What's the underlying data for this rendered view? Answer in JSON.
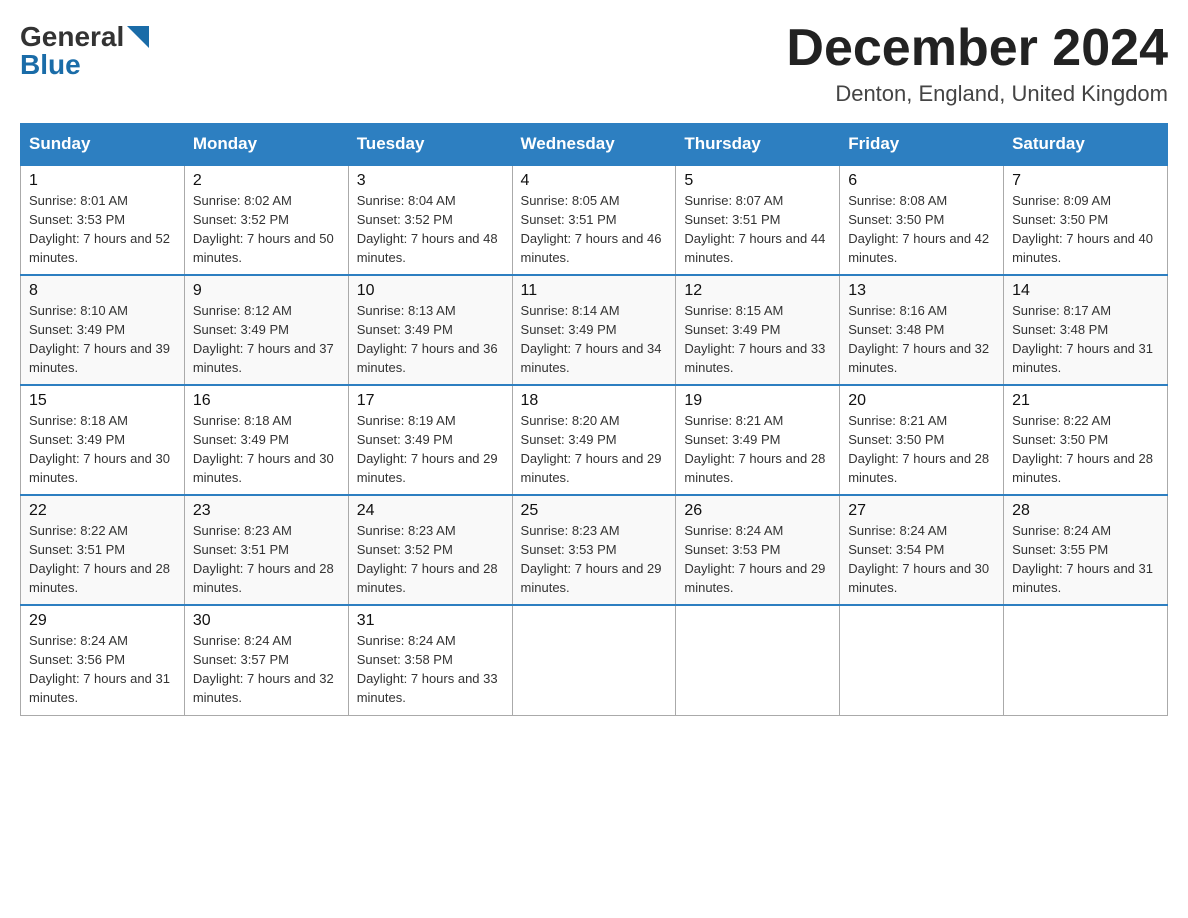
{
  "header": {
    "logo_general": "General",
    "logo_blue": "Blue",
    "month_title": "December 2024",
    "location": "Denton, England, United Kingdom"
  },
  "days_of_week": [
    "Sunday",
    "Monday",
    "Tuesday",
    "Wednesday",
    "Thursday",
    "Friday",
    "Saturday"
  ],
  "weeks": [
    [
      {
        "day": "1",
        "sunrise": "8:01 AM",
        "sunset": "3:53 PM",
        "daylight": "7 hours and 52 minutes."
      },
      {
        "day": "2",
        "sunrise": "8:02 AM",
        "sunset": "3:52 PM",
        "daylight": "7 hours and 50 minutes."
      },
      {
        "day": "3",
        "sunrise": "8:04 AM",
        "sunset": "3:52 PM",
        "daylight": "7 hours and 48 minutes."
      },
      {
        "day": "4",
        "sunrise": "8:05 AM",
        "sunset": "3:51 PM",
        "daylight": "7 hours and 46 minutes."
      },
      {
        "day": "5",
        "sunrise": "8:07 AM",
        "sunset": "3:51 PM",
        "daylight": "7 hours and 44 minutes."
      },
      {
        "day": "6",
        "sunrise": "8:08 AM",
        "sunset": "3:50 PM",
        "daylight": "7 hours and 42 minutes."
      },
      {
        "day": "7",
        "sunrise": "8:09 AM",
        "sunset": "3:50 PM",
        "daylight": "7 hours and 40 minutes."
      }
    ],
    [
      {
        "day": "8",
        "sunrise": "8:10 AM",
        "sunset": "3:49 PM",
        "daylight": "7 hours and 39 minutes."
      },
      {
        "day": "9",
        "sunrise": "8:12 AM",
        "sunset": "3:49 PM",
        "daylight": "7 hours and 37 minutes."
      },
      {
        "day": "10",
        "sunrise": "8:13 AM",
        "sunset": "3:49 PM",
        "daylight": "7 hours and 36 minutes."
      },
      {
        "day": "11",
        "sunrise": "8:14 AM",
        "sunset": "3:49 PM",
        "daylight": "7 hours and 34 minutes."
      },
      {
        "day": "12",
        "sunrise": "8:15 AM",
        "sunset": "3:49 PM",
        "daylight": "7 hours and 33 minutes."
      },
      {
        "day": "13",
        "sunrise": "8:16 AM",
        "sunset": "3:48 PM",
        "daylight": "7 hours and 32 minutes."
      },
      {
        "day": "14",
        "sunrise": "8:17 AM",
        "sunset": "3:48 PM",
        "daylight": "7 hours and 31 minutes."
      }
    ],
    [
      {
        "day": "15",
        "sunrise": "8:18 AM",
        "sunset": "3:49 PM",
        "daylight": "7 hours and 30 minutes."
      },
      {
        "day": "16",
        "sunrise": "8:18 AM",
        "sunset": "3:49 PM",
        "daylight": "7 hours and 30 minutes."
      },
      {
        "day": "17",
        "sunrise": "8:19 AM",
        "sunset": "3:49 PM",
        "daylight": "7 hours and 29 minutes."
      },
      {
        "day": "18",
        "sunrise": "8:20 AM",
        "sunset": "3:49 PM",
        "daylight": "7 hours and 29 minutes."
      },
      {
        "day": "19",
        "sunrise": "8:21 AM",
        "sunset": "3:49 PM",
        "daylight": "7 hours and 28 minutes."
      },
      {
        "day": "20",
        "sunrise": "8:21 AM",
        "sunset": "3:50 PM",
        "daylight": "7 hours and 28 minutes."
      },
      {
        "day": "21",
        "sunrise": "8:22 AM",
        "sunset": "3:50 PM",
        "daylight": "7 hours and 28 minutes."
      }
    ],
    [
      {
        "day": "22",
        "sunrise": "8:22 AM",
        "sunset": "3:51 PM",
        "daylight": "7 hours and 28 minutes."
      },
      {
        "day": "23",
        "sunrise": "8:23 AM",
        "sunset": "3:51 PM",
        "daylight": "7 hours and 28 minutes."
      },
      {
        "day": "24",
        "sunrise": "8:23 AM",
        "sunset": "3:52 PM",
        "daylight": "7 hours and 28 minutes."
      },
      {
        "day": "25",
        "sunrise": "8:23 AM",
        "sunset": "3:53 PM",
        "daylight": "7 hours and 29 minutes."
      },
      {
        "day": "26",
        "sunrise": "8:24 AM",
        "sunset": "3:53 PM",
        "daylight": "7 hours and 29 minutes."
      },
      {
        "day": "27",
        "sunrise": "8:24 AM",
        "sunset": "3:54 PM",
        "daylight": "7 hours and 30 minutes."
      },
      {
        "day": "28",
        "sunrise": "8:24 AM",
        "sunset": "3:55 PM",
        "daylight": "7 hours and 31 minutes."
      }
    ],
    [
      {
        "day": "29",
        "sunrise": "8:24 AM",
        "sunset": "3:56 PM",
        "daylight": "7 hours and 31 minutes."
      },
      {
        "day": "30",
        "sunrise": "8:24 AM",
        "sunset": "3:57 PM",
        "daylight": "7 hours and 32 minutes."
      },
      {
        "day": "31",
        "sunrise": "8:24 AM",
        "sunset": "3:58 PM",
        "daylight": "7 hours and 33 minutes."
      },
      null,
      null,
      null,
      null
    ]
  ]
}
